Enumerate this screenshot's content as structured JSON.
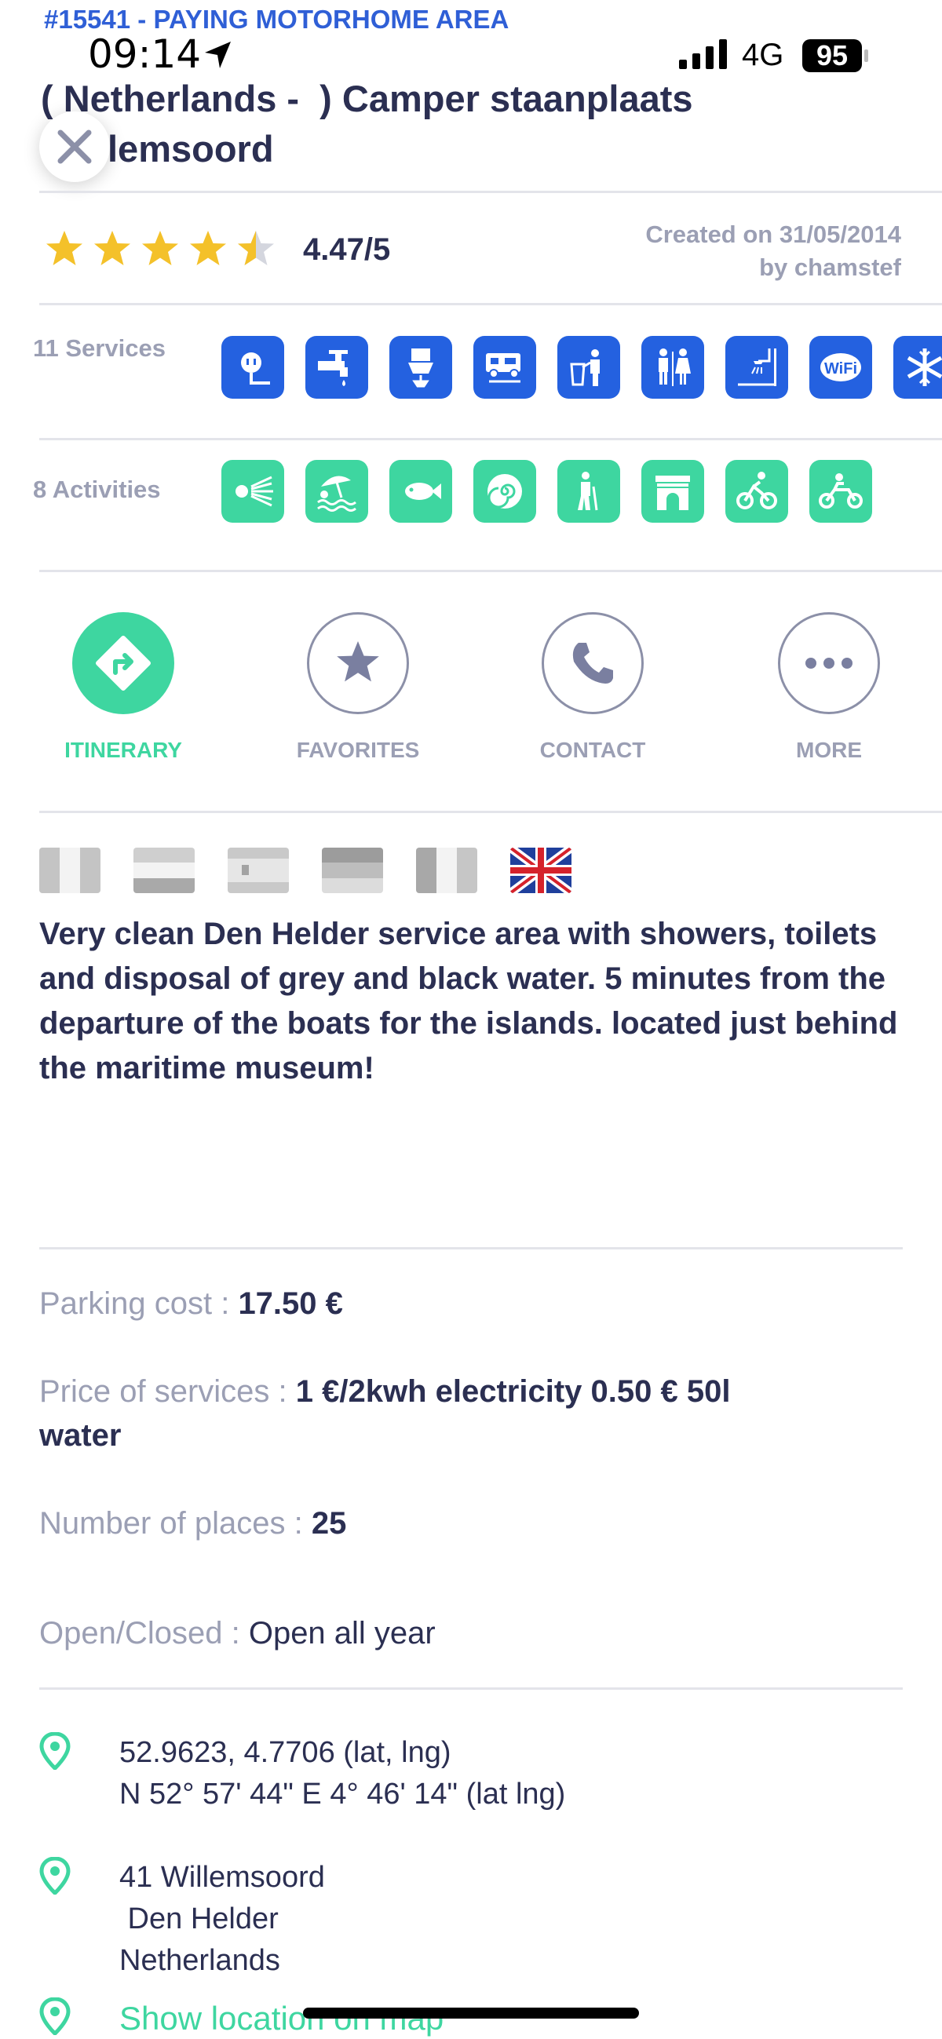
{
  "header": {
    "badge": "#15541 - PAYING MOTORHOME AREA",
    "title": "( Netherlands - ) Camper staanplaats Willemsoord",
    "title_visible": "lemsoord"
  },
  "status_bar": {
    "time": "09:14",
    "network": "4G",
    "battery": "95"
  },
  "rating": {
    "value": "4.47/5",
    "stars": 4.47,
    "created": "Created on 31/05/2014",
    "author": "by chamstef"
  },
  "services": {
    "label": "11 Services",
    "icons": [
      "electricity-icon",
      "water-tap-icon",
      "toilet-disposal-icon",
      "motorhome-drain-icon",
      "trash-icon",
      "toilets-icon",
      "shower-icon",
      "wifi-icon",
      "snowflake-icon"
    ]
  },
  "activities": {
    "label": "8 Activities",
    "icons": [
      "lighthouse-icon",
      "beach-icon",
      "fishing-icon",
      "shell-icon",
      "hiking-icon",
      "monument-icon",
      "cycling-icon",
      "motorbike-icon"
    ]
  },
  "actions": {
    "itinerary": "ITINERARY",
    "favorites": "FAVORITES",
    "contact": "CONTACT",
    "more": "MORE"
  },
  "description": "Very clean Den Helder service area with showers, toilets and disposal of grey and black water. 5 minutes from the departure of the boats for the islands.  located just behind the maritime museum!",
  "details": {
    "parking_label": "Parking cost : ",
    "parking_value": "17.50 €",
    "services_label": "Price of services : ",
    "services_value": "1 €/2kwh electricity 0.50 € 50l water",
    "places_label": "Number of places : ",
    "places_value": "25",
    "open_label": "Open/Closed : ",
    "open_value": "Open all year"
  },
  "location": {
    "coords": "52.9623, 4.7706 (lat, lng)\nN 52° 57' 44\" E 4° 46' 14\" (lat lng)",
    "address": "41 Willemsoord\n Den Helder\nNetherlands",
    "map_link": "Show location on map"
  },
  "colors": {
    "primary_green": "#3ed6a0",
    "service_blue": "#2461e0",
    "text_dark": "#2b2f52",
    "text_muted": "#9b9fb4",
    "star": "#f4c12a"
  }
}
